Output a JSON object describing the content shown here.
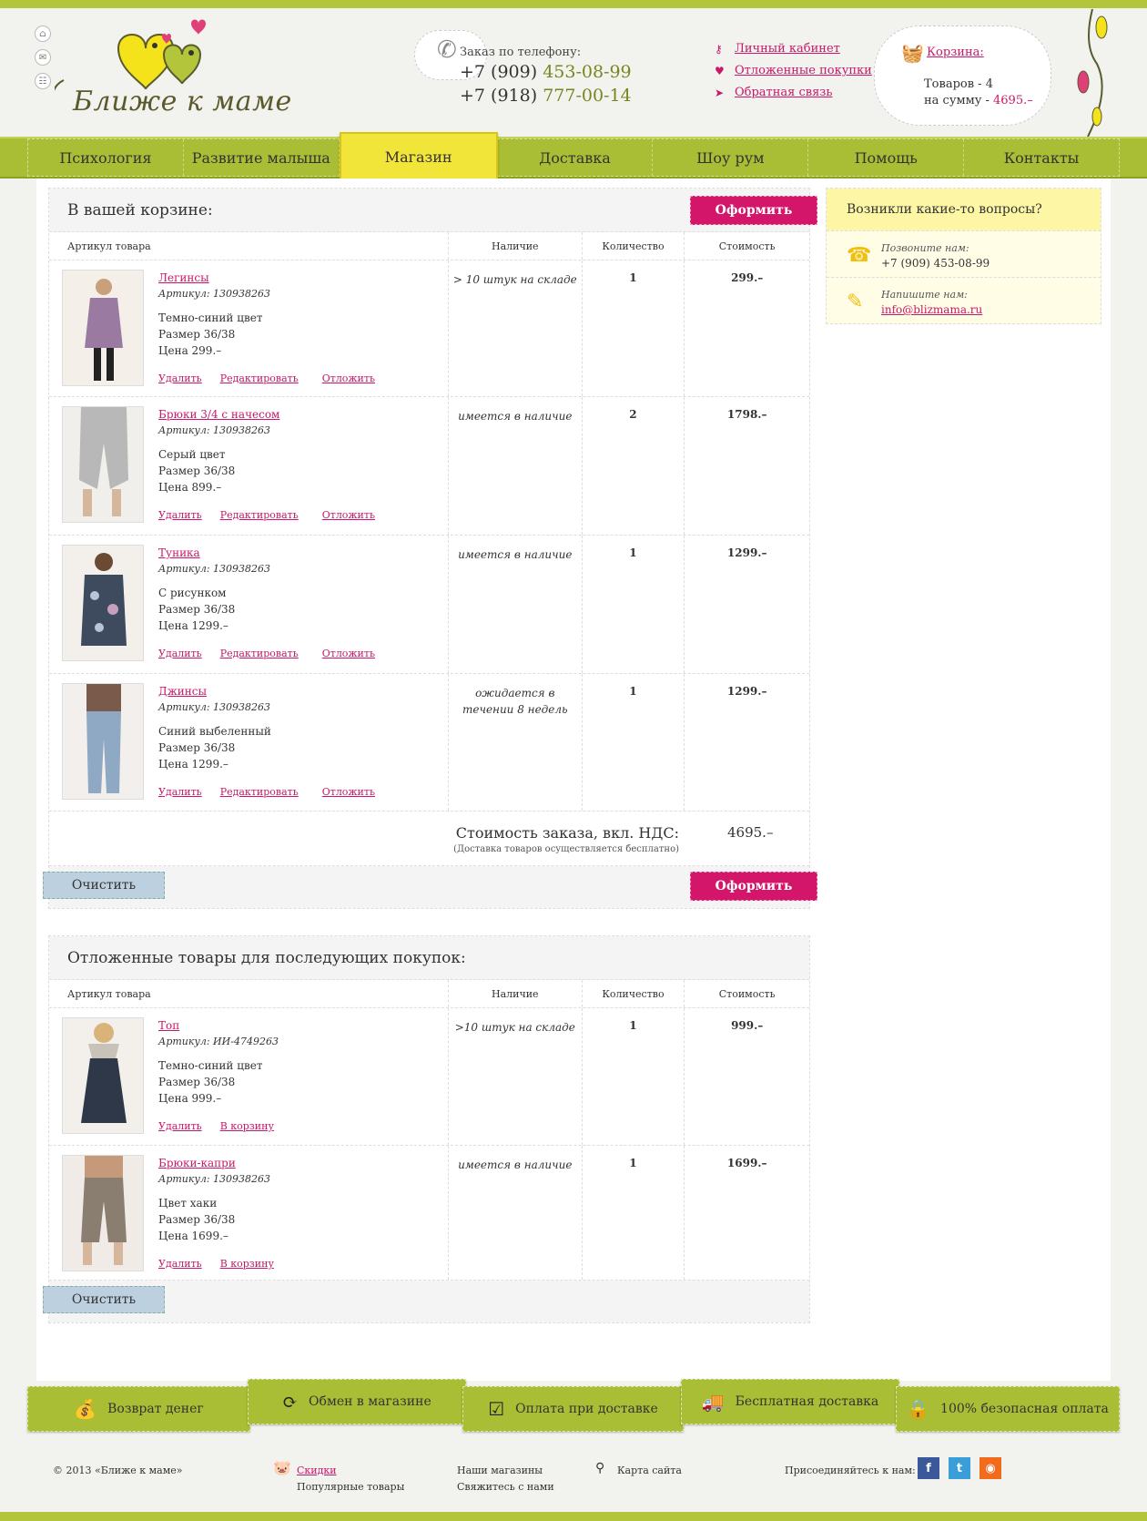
{
  "header": {
    "logo_text": "Ближе к маме",
    "phone_caption": "Заказ по телефону:",
    "phone1_prefix": "+7 (909)",
    "phone1_number": "453-08-99",
    "phone2_prefix": "+7 (918)",
    "phone2_number": "777-00-14",
    "links": [
      "Личный кабинет",
      "Отложенные покупки",
      "Обратная связь"
    ],
    "cart_label": "Корзина:",
    "cart_items": "Товаров - 4",
    "cart_sum_prefix": "на сумму -",
    "cart_sum": "4695.–"
  },
  "nav": [
    "Психология",
    "Развитие малыша",
    "Магазин",
    "Доставка",
    "Шоу рум",
    "Помощь",
    "Контакты"
  ],
  "cart": {
    "title": "В вашей корзине:",
    "checkout": "Оформить",
    "clear": "Очистить",
    "columns": [
      "Артикул товара",
      "Наличие",
      "Количество",
      "Стоимость"
    ],
    "items": [
      {
        "name": "Легинсы",
        "art_label": "Артикул:",
        "art": "130938263",
        "d1": "Темно-синий цвет",
        "d2": "Размер 36/38",
        "d3": "Цена 299.–",
        "avail": "> 10 штук на складе",
        "qty": "1",
        "price": "299.–",
        "a1": "Удалить",
        "a2": "Редактировать",
        "a3": "Отложить"
      },
      {
        "name": "Брюки 3/4 с начесом",
        "art_label": "Артикул:",
        "art": "130938263",
        "d1": "Серый цвет",
        "d2": "Размер 36/38",
        "d3": "Цена 899.–",
        "avail": "имеется в наличие",
        "qty": "2",
        "price": "1798.–",
        "a1": "Удалить",
        "a2": "Редактировать",
        "a3": "Отложить"
      },
      {
        "name": "Туника",
        "art_label": "Артикул:",
        "art": "130938263",
        "d1": "С рисунком",
        "d2": "Размер 36/38",
        "d3": "Цена 1299.–",
        "avail": "имеется в наличие",
        "qty": "1",
        "price": "1299.–",
        "a1": "Удалить",
        "a2": "Редактировать",
        "a3": "Отложить"
      },
      {
        "name": "Джинсы",
        "art_label": "Артикул:",
        "art": "130938263",
        "d1": "Синий выбеленный",
        "d2": "Размер 36/38",
        "d3": "Цена 1299.–",
        "avail": "ожидается в течении 8 недель",
        "qty": "1",
        "price": "1299.–",
        "a1": "Удалить",
        "a2": "Редактировать",
        "a3": "Отложить"
      }
    ],
    "total_label": "Стоимость заказа, вкл. НДС:",
    "total_note": "(Доставка товаров осуществляется бесплатно)",
    "total": "4695.–"
  },
  "deferred": {
    "title": "Отложенные товары для последующих покупок:",
    "clear": "Очистить",
    "columns": [
      "Артикул товара",
      "Наличие",
      "Количество",
      "Стоимость"
    ],
    "items": [
      {
        "name": "Топ",
        "art_label": "Артикул:",
        "art": "ИИ-4749263",
        "d1": "Темно-синий цвет",
        "d2": "Размер 36/38",
        "d3": "Цена 999.–",
        "avail": ">10 штук на складе",
        "qty": "1",
        "price": "999.–",
        "a1": "Удалить",
        "a2": "В корзину"
      },
      {
        "name": "Брюки-капри",
        "art_label": "Артикул:",
        "art": "130938263",
        "d1": "Цвет хаки",
        "d2": "Размер 36/38",
        "d3": "Цена 1699.–",
        "avail": "имеется в наличие",
        "qty": "1",
        "price": "1699.–",
        "a1": "Удалить",
        "a2": "В корзину"
      }
    ]
  },
  "side": {
    "title": "Возникли какие-то вопросы?",
    "call_label": "Позвоните нам:",
    "call_value": "+7 (909) 453-08-99",
    "write_label": "Напишите нам:",
    "write_value": "info@blizmama.ru"
  },
  "banners": [
    "Возврат денег",
    "Обмен в магазине",
    "Оплата при доставке",
    "Бесплатная доставка",
    "100% безопасная оплата"
  ],
  "footer": {
    "copyright": "© 2013  «Ближе к маме»",
    "l1": "Скидки",
    "l2": "Популярные товары",
    "l3": "Наши магазины",
    "l4": "Свяжитесь с нами",
    "l5": "Карта сайта",
    "join": "Присоединяйтесь к нам:"
  },
  "colors": {
    "accent": "#c8186a",
    "green": "#a9be34",
    "yellow": "#f2e53a",
    "blue_button": "#bdd0e0"
  }
}
